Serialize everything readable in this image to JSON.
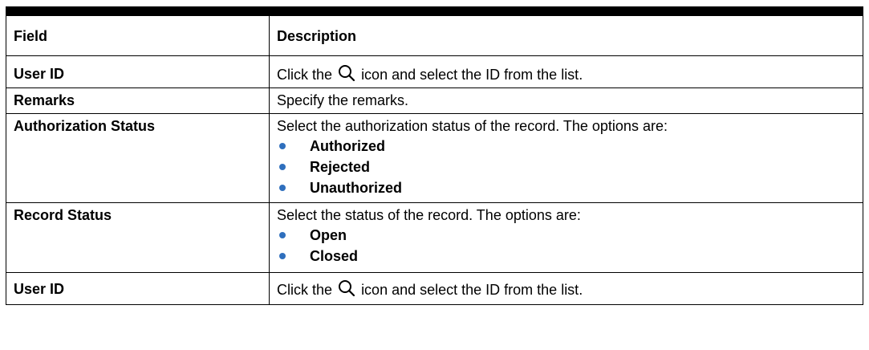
{
  "header": {
    "field": "Field",
    "description": "Description"
  },
  "rows": [
    {
      "field": "User ID",
      "desc_before": "Click the",
      "desc_after": "icon and select the ID from the list."
    },
    {
      "field": "Remarks",
      "description": "Specify the remarks."
    },
    {
      "field": "Authorization Status",
      "description": "Select the authorization status of the record. The options are:",
      "options": [
        "Authorized",
        "Rejected",
        "Unauthorized"
      ]
    },
    {
      "field": "Record Status",
      "description": "Select the status of the record. The options are:",
      "options": [
        "Open",
        "Closed"
      ]
    },
    {
      "field": "User ID",
      "desc_before": "Click the",
      "desc_after": "icon and select the ID from the list."
    }
  ],
  "icons": {
    "lookup": "search-icon"
  },
  "colors": {
    "bullet": "#2f6fbd",
    "rule": "#000000"
  }
}
